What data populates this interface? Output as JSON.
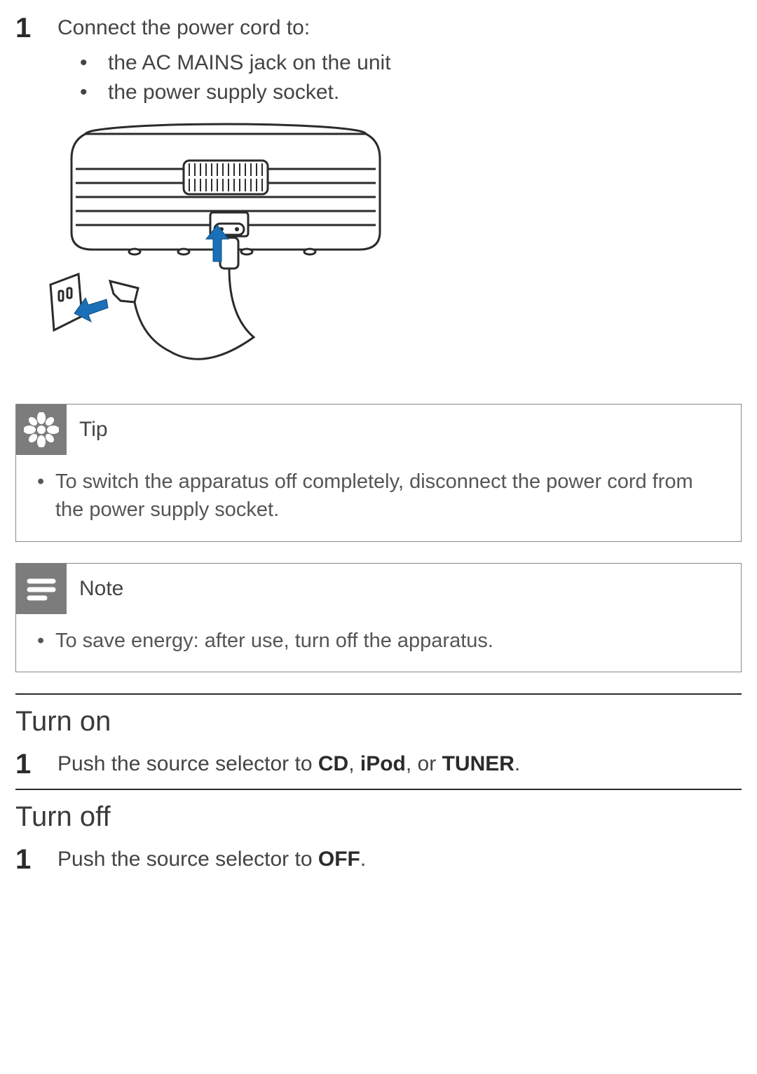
{
  "step1": {
    "number": "1",
    "text": "Connect the power cord to:",
    "bullets": [
      "the AC MAINS jack on the unit",
      "the power supply socket."
    ]
  },
  "tip": {
    "title": "Tip",
    "items": [
      "To switch the apparatus off completely, disconnect the power cord from the power supply socket."
    ]
  },
  "note": {
    "title": "Note",
    "items": [
      "To save energy: after use, turn off the apparatus."
    ]
  },
  "turn_on": {
    "heading": "Turn on",
    "step_num": "1",
    "step_prefix": "Push the source selector to ",
    "opt1": "CD",
    "sep1": ", ",
    "opt2": "iPod",
    "sep2": ", or ",
    "opt3": "TUNER",
    "suffix": "."
  },
  "turn_off": {
    "heading": "Turn off",
    "step_num": "1",
    "step_prefix": "Push the source selector to ",
    "opt1": "OFF",
    "suffix": "."
  }
}
